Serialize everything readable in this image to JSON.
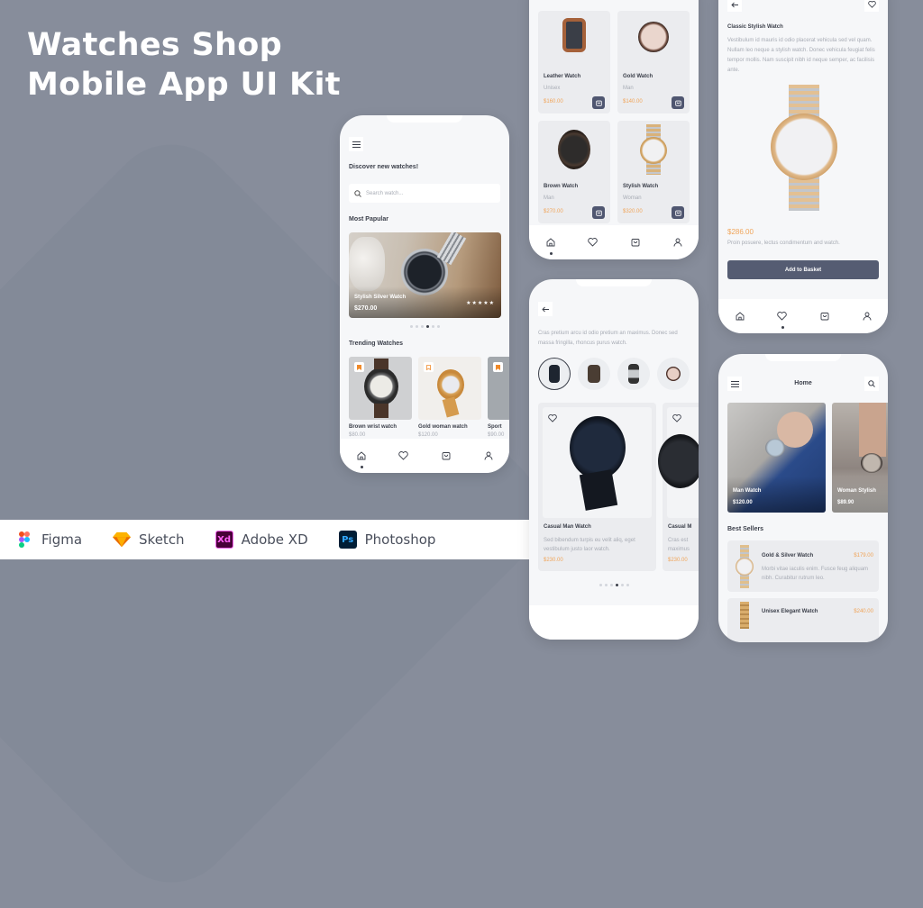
{
  "title": {
    "line1": "Watches Shop",
    "line2": "Mobile App UI Kit"
  },
  "tools": [
    {
      "icon": "figma-icon",
      "label": "Figma"
    },
    {
      "icon": "sketch-icon",
      "label": "Sketch",
      "badge": ""
    },
    {
      "icon": "adobe-xd-icon",
      "label": "Adobe XD",
      "badge": "Xd"
    },
    {
      "icon": "photoshop-icon",
      "label": "Photoshop",
      "badge": "Ps"
    }
  ],
  "colors": {
    "accent": "#f0a55a",
    "primary": "#4f5670",
    "background": "#878d9b"
  },
  "home_screen": {
    "heading": "Discover new watches!",
    "search_placeholder": "Search watch...",
    "most_popular_title": "Most Papular",
    "featured": {
      "name": "Stylish Silver Watch",
      "price": "$270.00",
      "rating": 5,
      "rating_stars": "★★★★★"
    },
    "trending_title": "Trending Watches",
    "trending": [
      {
        "name": "Brown wrist watch",
        "price": "$80.00"
      },
      {
        "name": "Gold woman watch",
        "price": "$120.00"
      },
      {
        "name": "Sport",
        "price": "$90.00"
      }
    ]
  },
  "grid_screen": {
    "products": [
      {
        "name": "Leather Watch",
        "category": "Unisex",
        "price": "$160.00"
      },
      {
        "name": "Gold Watch",
        "category": "Man",
        "price": "$140.00"
      },
      {
        "name": "Brown Watch",
        "category": "Man",
        "price": "$270.00"
      },
      {
        "name": "Stylish Watch",
        "category": "Woman",
        "price": "$320.00"
      }
    ]
  },
  "category_screen": {
    "description": "Cras pretium arcu id odio pretium an maximus. Donec sed massa fringilla, rhoncus purus watch.",
    "cards": [
      {
        "name": "Casual Man Watch",
        "description": "Sed bibendum turpis eu velit aliq, eget vestibulum justo laor watch.",
        "price": "$230.00"
      },
      {
        "name": "Casual M",
        "description": "Cras est maximus",
        "price": "$230.00"
      }
    ]
  },
  "detail_screen": {
    "name": "Classic Stylish Watch",
    "description": "Vestibulum id mauris id odio placerat vehicula sed vel quam. Nullam leo neque a stylish watch. Donec vehicula feugiat felis tempor mollis. Nam suscipit nibh id neque semper, ac facilisis ante.",
    "price": "$286.00",
    "subtext": "Proin posuere, lectus condimentum and watch.",
    "add_button": "Add to Basket"
  },
  "home2_screen": {
    "title": "Home",
    "banners": [
      {
        "name": "Man Watch",
        "price": "$120.00"
      },
      {
        "name": "Woman Stylish",
        "price": "$89.90"
      }
    ],
    "best_sellers_title": "Best Sellers",
    "best_sellers": [
      {
        "name": "Gold & Silver Watch",
        "price": "$179.00",
        "description": "Morbi vitae iaculis enim. Fusce feug aliquam nibh. Curabitur rutrum leo."
      },
      {
        "name": "Unisex Elegant Watch",
        "price": "$240.00"
      }
    ]
  }
}
